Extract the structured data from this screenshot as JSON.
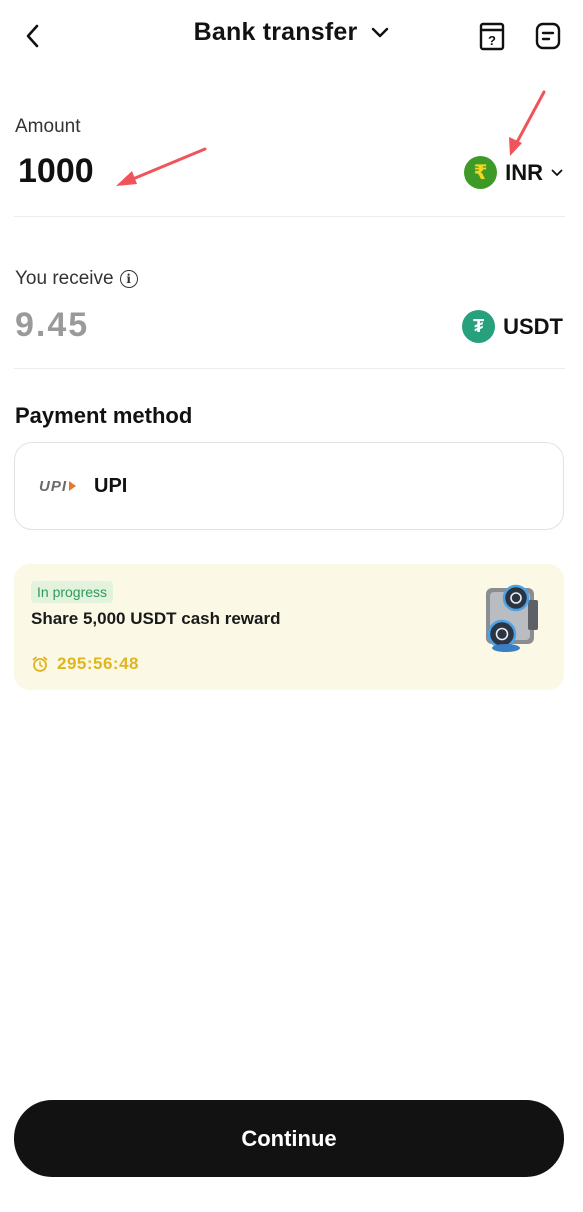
{
  "header": {
    "title": "Bank transfer",
    "back_icon": "chevron-left-icon",
    "title_dropdown_icon": "chevron-down-icon",
    "help_icon": "question-box-icon",
    "orders_icon": "order-list-icon"
  },
  "amount": {
    "label": "Amount",
    "value": "1000",
    "currency": {
      "code": "INR",
      "symbol": "₹",
      "icon": "rupee-coin-icon"
    }
  },
  "receive": {
    "label": "You receive",
    "info_icon": "info-icon",
    "value": "9.45",
    "currency": {
      "code": "USDT",
      "symbol": "₮",
      "icon": "tether-coin-icon"
    }
  },
  "payment": {
    "title": "Payment method",
    "method": {
      "logo_text": "UPI",
      "name": "UPI"
    }
  },
  "promo": {
    "badge": "In progress",
    "text": "Share 5,000 USDT cash reward",
    "timer": "295:56:48",
    "timer_icon": "alarm-clock-icon",
    "image_icon": "wallet-coins-icon"
  },
  "footer": {
    "continue_label": "Continue"
  },
  "colors": {
    "accent_green": "#26a17b",
    "rupee_green": "#3e9a27",
    "timer_yellow": "#e1b51c",
    "badge_green": "#2f9a59",
    "annotation_red": "#f0545a",
    "button_dark": "#121212"
  }
}
